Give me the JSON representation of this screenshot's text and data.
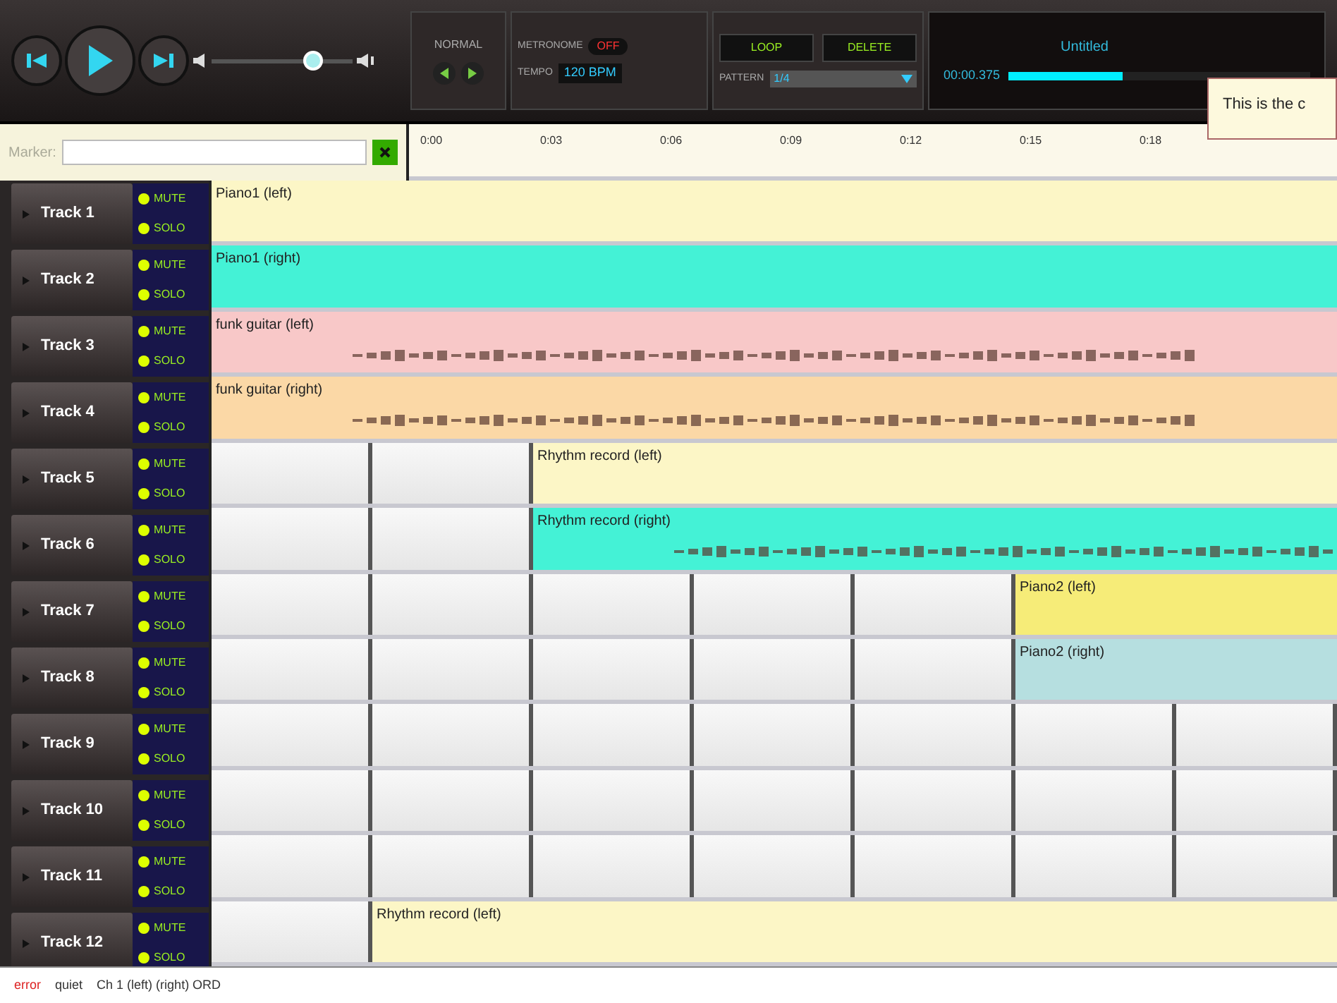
{
  "transport": {
    "volume": {
      "level": 0.72
    }
  },
  "mode": {
    "label": "NORMAL"
  },
  "metronome": {
    "label": "METRONOME",
    "value": "OFF",
    "on": false
  },
  "tempo": {
    "label": "TEMPO",
    "value": "120 BPM"
  },
  "buttons": [
    "LOOP",
    "DELETE"
  ],
  "pattern": {
    "label": "PATTERN",
    "value": "1/4"
  },
  "display": {
    "title": "Untitled",
    "time": "00:00.375",
    "progress": {
      "level": 0.38
    }
  },
  "tooltip": "This is the c",
  "marker": {
    "label": "Marker:"
  },
  "ruler": [
    "0:00",
    "0:03",
    "0:06",
    "0:09",
    "0:12",
    "0:15",
    "0:18"
  ],
  "tracks": [
    {
      "name": "Track 1",
      "controls": [
        "MUTE",
        "SOLO"
      ],
      "lane": [
        {
          "kind": "clip",
          "label": "Piano1 (left)",
          "color": "#fcf6c6",
          "waveform": false
        }
      ]
    },
    {
      "name": "Track 2",
      "controls": [
        "MUTE",
        "SOLO"
      ],
      "lane": [
        {
          "kind": "clip",
          "label": "Piano1 (right)",
          "color": "#44f2d6",
          "waveform": false
        }
      ]
    },
    {
      "name": "Track 3",
      "controls": [
        "MUTE",
        "SOLO"
      ],
      "lane": [
        {
          "kind": "clip",
          "label": "funk guitar (left)",
          "color": "#f8c8c8",
          "waveform": true
        }
      ]
    },
    {
      "name": "Track 4",
      "controls": [
        "MUTE",
        "SOLO"
      ],
      "lane": [
        {
          "kind": "clip",
          "label": "funk guitar (right)",
          "color": "#fbd8a6",
          "waveform": true
        }
      ]
    },
    {
      "name": "Track 5",
      "controls": [
        "MUTE",
        "SOLO"
      ],
      "lane": [
        {
          "kind": "empty"
        },
        {
          "kind": "empty"
        },
        {
          "kind": "clip",
          "label": "Rhythm record (left)",
          "color": "#fcf6c6",
          "waveform": false
        }
      ]
    },
    {
      "name": "Track 6",
      "controls": [
        "MUTE",
        "SOLO"
      ],
      "lane": [
        {
          "kind": "empty"
        },
        {
          "kind": "empty"
        },
        {
          "kind": "clip",
          "label": "Rhythm record (right)",
          "color": "#44f2d6",
          "waveform": true
        }
      ]
    },
    {
      "name": "Track 7",
      "controls": [
        "MUTE",
        "SOLO"
      ],
      "lane": [
        {
          "kind": "empty"
        },
        {
          "kind": "empty"
        },
        {
          "kind": "empty"
        },
        {
          "kind": "empty"
        },
        {
          "kind": "empty"
        },
        {
          "kind": "clip",
          "label": "Piano2 (left)",
          "color": "#f6ec78",
          "waveform": false
        }
      ]
    },
    {
      "name": "Track 8",
      "controls": [
        "MUTE",
        "SOLO"
      ],
      "lane": [
        {
          "kind": "empty"
        },
        {
          "kind": "empty"
        },
        {
          "kind": "empty"
        },
        {
          "kind": "empty"
        },
        {
          "kind": "empty"
        },
        {
          "kind": "clip",
          "label": "Piano2 (right)",
          "color": "#b6dfe0",
          "waveform": false
        }
      ]
    },
    {
      "name": "Track 9",
      "controls": [
        "MUTE",
        "SOLO"
      ],
      "lane": [
        {
          "kind": "empty"
        },
        {
          "kind": "empty"
        },
        {
          "kind": "empty"
        },
        {
          "kind": "empty"
        },
        {
          "kind": "empty"
        },
        {
          "kind": "empty"
        },
        {
          "kind": "empty"
        }
      ]
    },
    {
      "name": "Track 10",
      "controls": [
        "MUTE",
        "SOLO"
      ],
      "lane": [
        {
          "kind": "empty"
        },
        {
          "kind": "empty"
        },
        {
          "kind": "empty"
        },
        {
          "kind": "empty"
        },
        {
          "kind": "empty"
        },
        {
          "kind": "empty"
        },
        {
          "kind": "empty"
        }
      ]
    },
    {
      "name": "Track 11",
      "controls": [
        "MUTE",
        "SOLO"
      ],
      "lane": [
        {
          "kind": "empty"
        },
        {
          "kind": "empty"
        },
        {
          "kind": "empty"
        },
        {
          "kind": "empty"
        },
        {
          "kind": "empty"
        },
        {
          "kind": "empty"
        },
        {
          "kind": "empty"
        }
      ]
    },
    {
      "name": "Track 12",
      "controls": [
        "MUTE",
        "SOLO"
      ],
      "lane": [
        {
          "kind": "empty"
        },
        {
          "kind": "clip",
          "label": "Rhythm record (left)",
          "color": "#fcf6c6",
          "waveform": false
        }
      ]
    }
  ],
  "status_bar": {
    "items": [
      "error",
      "quiet",
      "Ch 1 (left) (right) ORD"
    ]
  }
}
